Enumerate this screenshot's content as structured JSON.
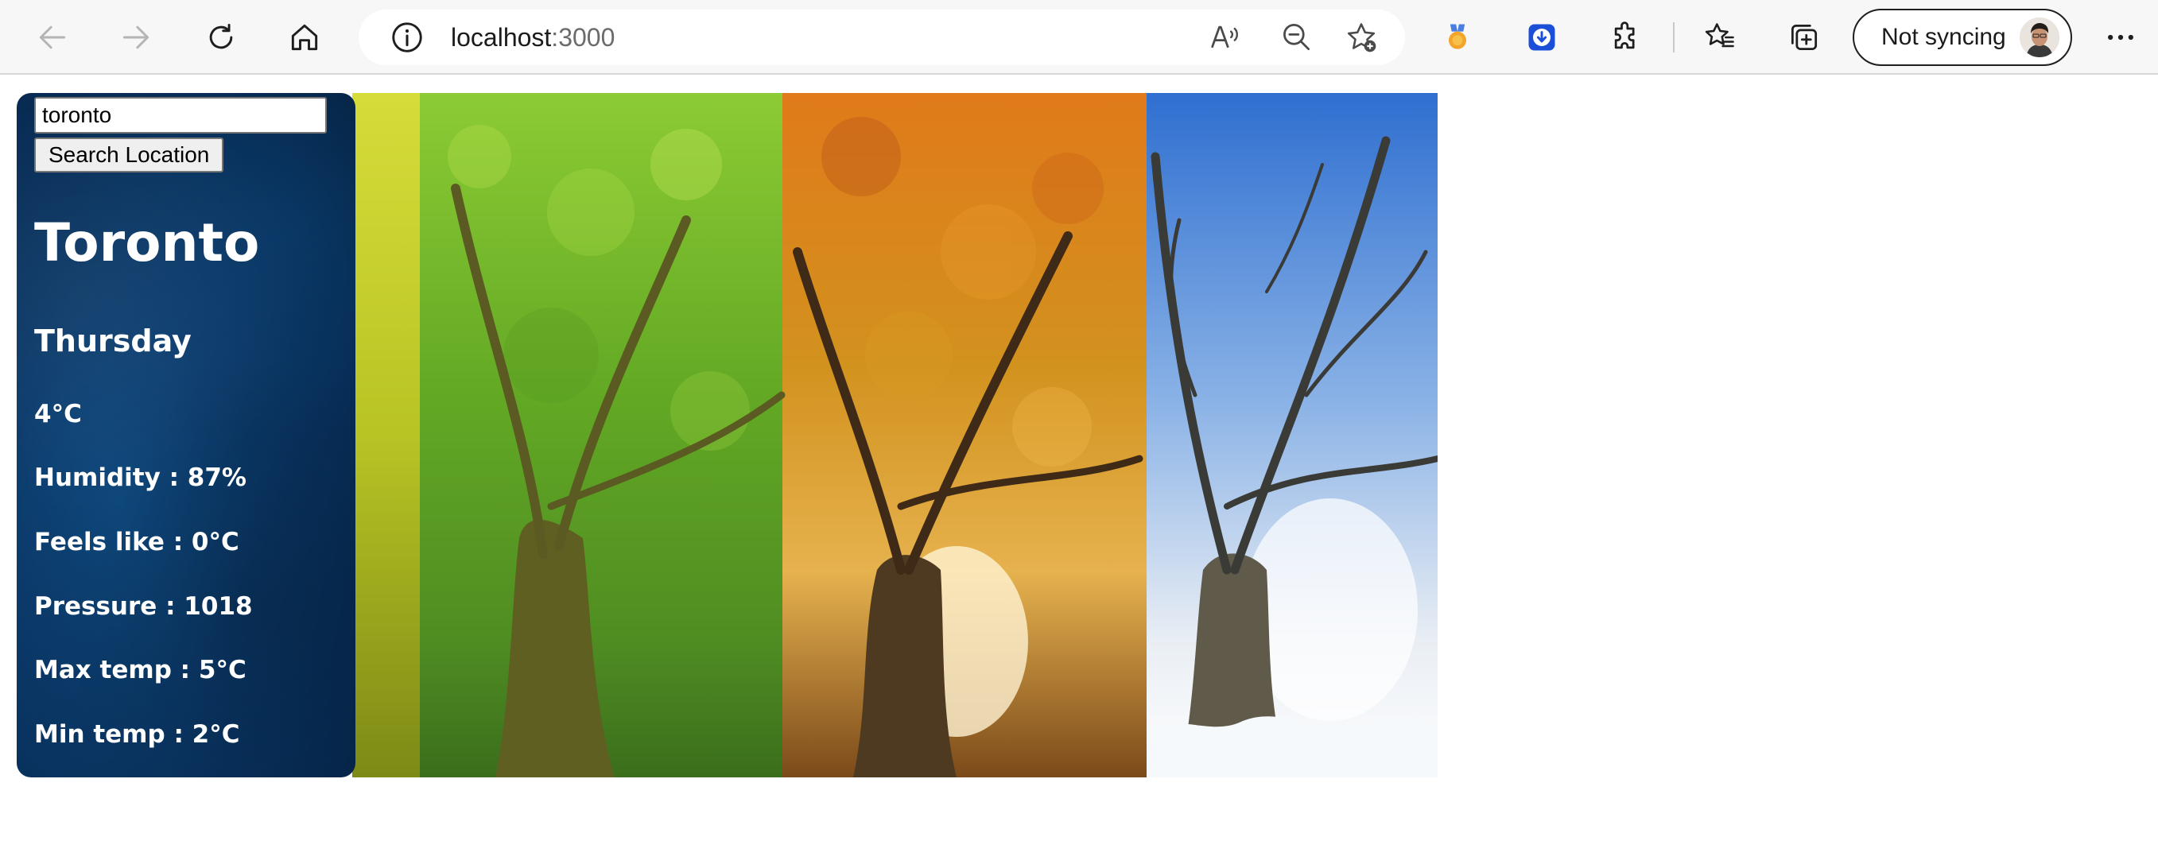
{
  "browser": {
    "url_host": "localhost",
    "url_port": ":3000",
    "sync_label": "Not syncing",
    "icons": {
      "back": "back-arrow-icon",
      "forward": "forward-arrow-icon",
      "refresh": "refresh-icon",
      "home": "home-icon",
      "site_info": "info-icon",
      "read_aloud": "read-aloud-icon",
      "zoom": "zoom-out-icon",
      "add_favorite": "add-favorite-icon",
      "extension_badge": "medal-extension-icon",
      "extension_download": "download-extension-icon",
      "extensions": "puzzle-icon",
      "favorites": "favorites-icon",
      "collections": "collections-icon",
      "menu": "more-icon"
    }
  },
  "search": {
    "value": "toronto",
    "button_label": "Search Location"
  },
  "weather": {
    "city": "Toronto",
    "day": "Thursday",
    "temperature": "4°C",
    "humidity": "Humidity : 87%",
    "feels_like": "Feels like : 0°C",
    "pressure": "Pressure : 1018",
    "max_temp": "Max temp : 5°C",
    "min_temp": "Min temp : 2°C"
  },
  "colors": {
    "panel_bg": "#0a3766",
    "season_spring": "#c5d12a",
    "season_summer": "#6fb62e",
    "season_autumn": "#d8811e",
    "season_winter": "#4a86d2"
  }
}
